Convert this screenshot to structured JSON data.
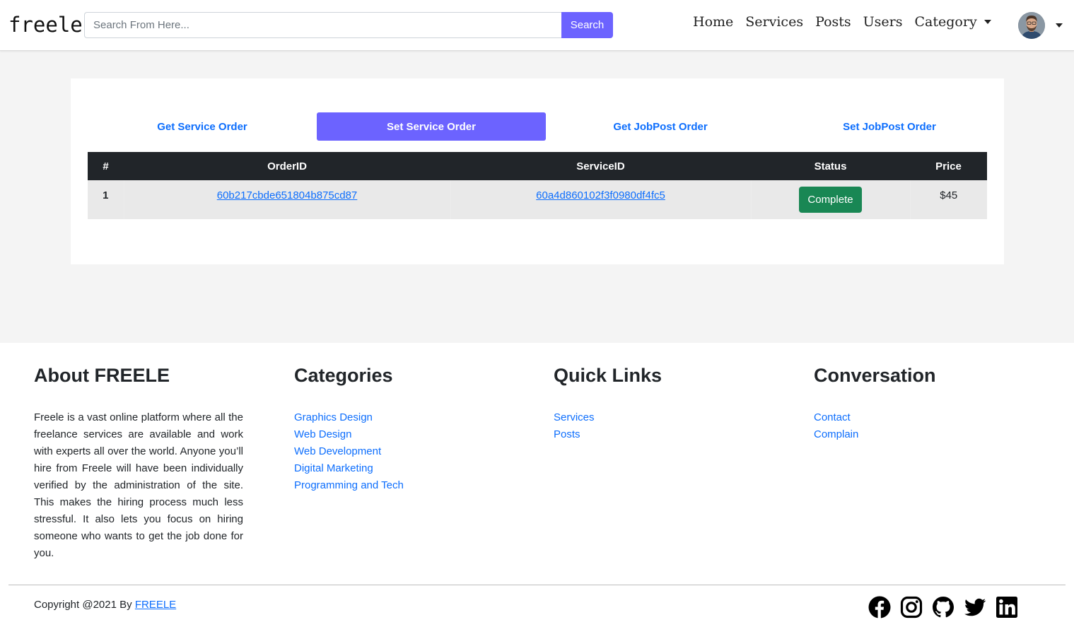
{
  "navbar": {
    "brand": "freele",
    "search": {
      "placeholder": "Search From Here...",
      "button_label": "Search"
    },
    "links": [
      "Home",
      "Services",
      "Posts",
      "Users"
    ],
    "category_label": "Category"
  },
  "tabs": [
    {
      "label": "Get Service Order",
      "active": false
    },
    {
      "label": "Set Service Order",
      "active": true
    },
    {
      "label": "Get JobPost Order",
      "active": false
    },
    {
      "label": "Set JobPost Order",
      "active": false
    }
  ],
  "table": {
    "headers": [
      "#",
      "OrderID",
      "ServiceID",
      "Status",
      "Price"
    ],
    "rows": [
      {
        "num": "1",
        "order_id": "60b217cbde651804b875cd87",
        "service_id": "60a4d860102f3f0980df4fc5",
        "status": "Complete",
        "price": "$45"
      }
    ]
  },
  "footer": {
    "about": {
      "title": "About FREELE",
      "text": "Freele is a vast online platform where all the freelance services are available and work with experts all over the world. Anyone you’ll hire from Freele will have been individually verified by the administration of the site. This makes the hiring process much less stressful. It also lets you focus on hiring someone who wants to get the job done for you."
    },
    "categories": {
      "title": "Categories",
      "items": [
        "Graphics Design",
        "Web Design",
        "Web Development",
        "Digital Marketing",
        "Programming and Tech"
      ]
    },
    "quick_links": {
      "title": "Quick Links",
      "items": [
        "Services",
        "Posts"
      ]
    },
    "conversation": {
      "title": "Conversation",
      "items": [
        "Contact",
        "Complain"
      ]
    },
    "copyright_prefix": "Copyright @2021 By ",
    "copyright_link": "FREELE",
    "socials": [
      "facebook-icon",
      "instagram-icon",
      "github-icon",
      "twitter-icon",
      "linkedin-icon"
    ]
  },
  "colors": {
    "accent": "#6c63ff",
    "link": "#0d6efd",
    "status_complete": "#198754",
    "table_header": "#212529"
  }
}
